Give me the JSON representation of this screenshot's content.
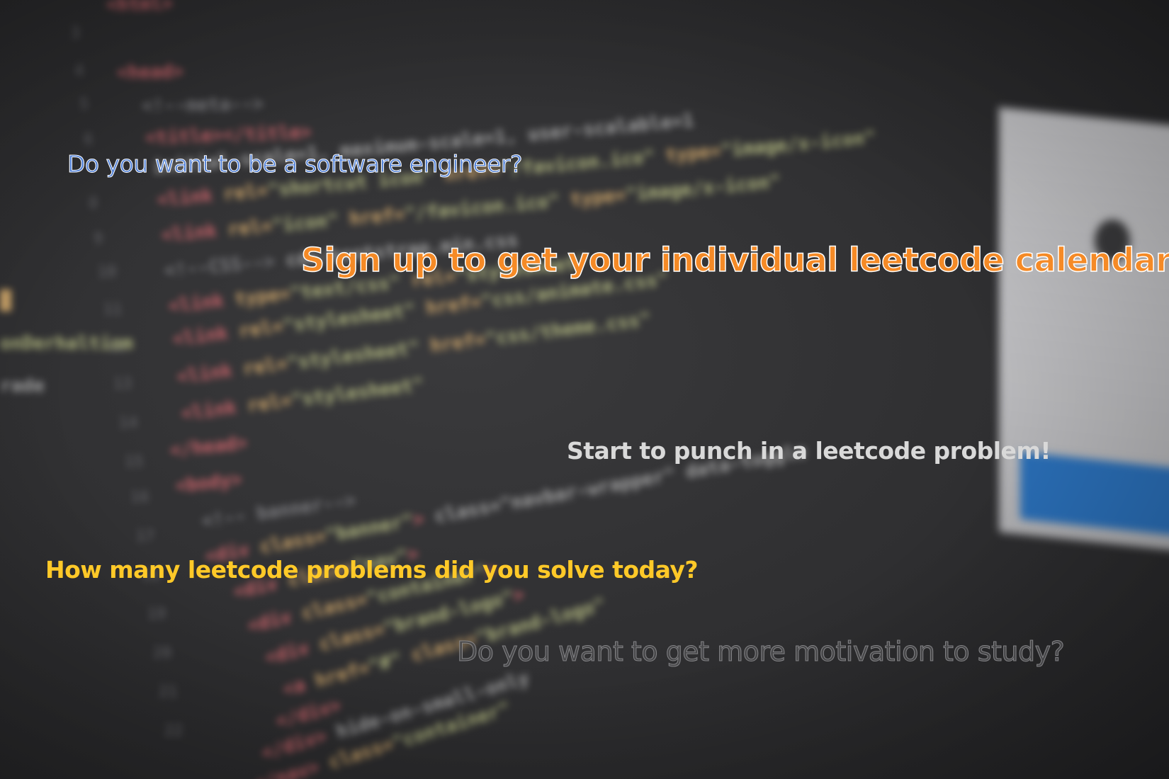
{
  "background": {
    "description_icon": "blurred-code-editor",
    "colors": {
      "base": "#2e2e30",
      "tag": "#e26b73",
      "attribute": "#e8b973",
      "string": "#c8cf8d"
    }
  },
  "headlines": {
    "engineer": "Do you want to be a software engineer?",
    "signup": "Sign up to get your individual leetcode calendar!",
    "punch": "Start to punch in a leetcode problem!",
    "solve": "How many leetcode problems did you solve today?",
    "motivation": "Do you want to get more motivation to study?"
  },
  "colors": {
    "engineer": "#4f7fd6",
    "signup": "#f58a26",
    "punch": "#d9d9d9",
    "solve": "#ffc928",
    "motivation": "#4a4a4c"
  }
}
